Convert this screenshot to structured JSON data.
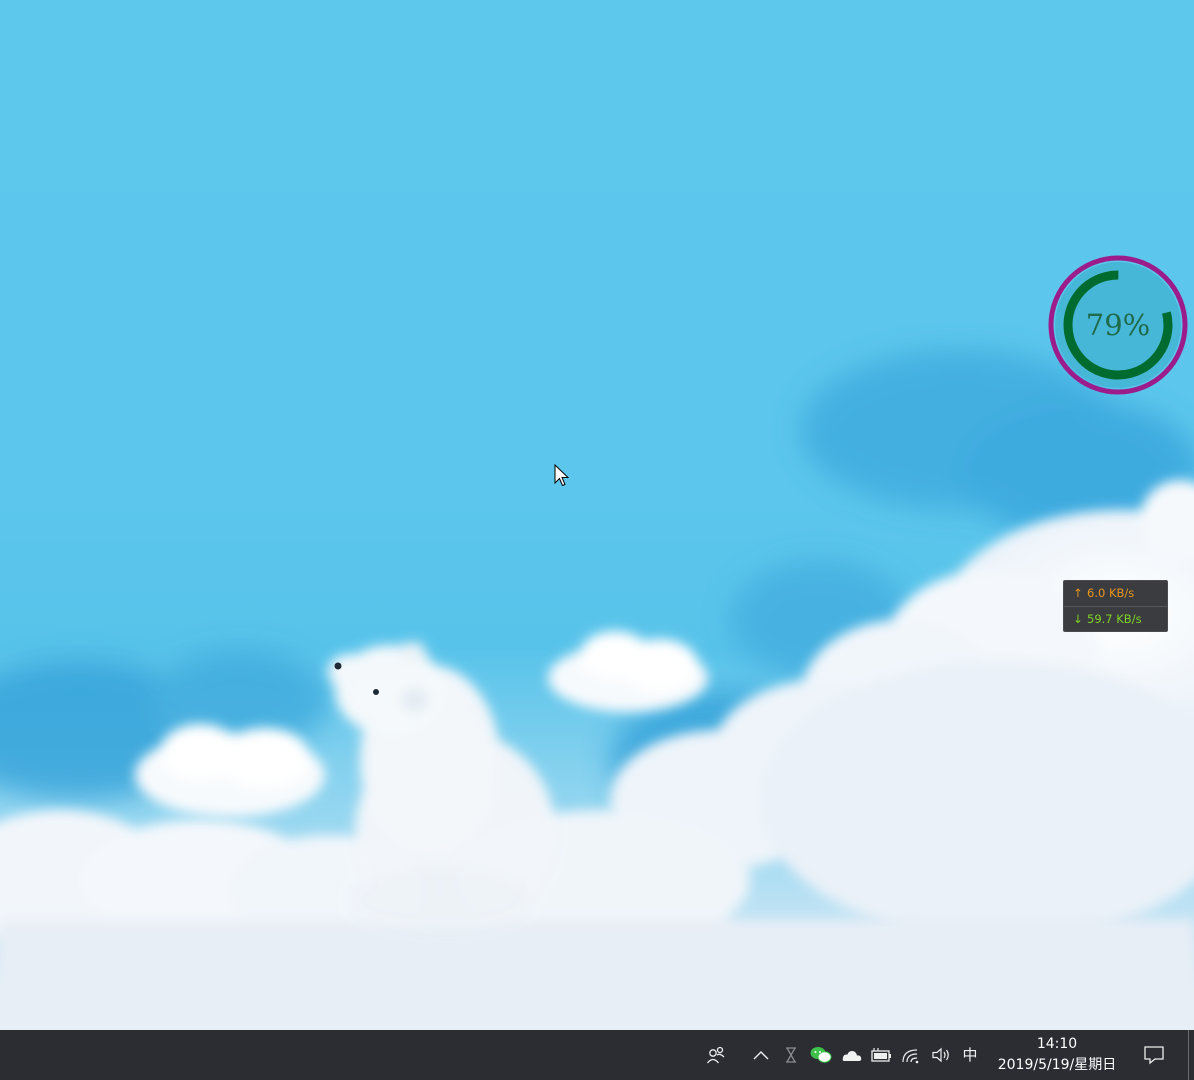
{
  "memory_widget": {
    "percent_label": "79%",
    "percent_value": 0.79
  },
  "net_speed": {
    "upload": "6.0 KB/s",
    "download": "59.7 KB/s",
    "upload_arrow": "↑",
    "download_arrow": "↓"
  },
  "taskbar": {
    "ime_label": "中",
    "clock_time": "14:10",
    "clock_date": "2019/5/19/星期日",
    "tray_icons": [
      "people-icon",
      "show-hidden-icons-chevron",
      "hourglass-icon",
      "wechat-icon",
      "onedrive-icon",
      "battery-icon",
      "wifi-icon",
      "volume-icon",
      "action-center-icon"
    ]
  },
  "colors": {
    "sky": "#5cc6ec",
    "taskbar": "#2b2d33",
    "gauge_ring_outer": "#9b1c8a",
    "gauge_ring_inner": "#006b2e",
    "upload_text": "#e8961c",
    "download_text": "#7ed321"
  }
}
